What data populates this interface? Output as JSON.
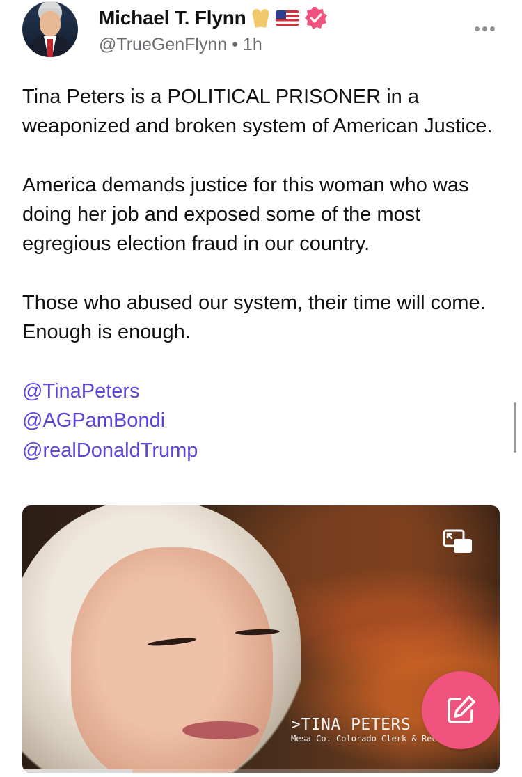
{
  "post": {
    "author": {
      "display_name": "Michael T. Flynn",
      "badges": [
        "folded-hands-emoji",
        "us-flag-emoji",
        "verified-badge-icon"
      ],
      "handle": "@TrueGenFlynn",
      "separator": "•",
      "time_ago": "1h"
    },
    "menu_icon": "more-horizontal-icon",
    "paragraphs": [
      "Tina Peters is a POLITICAL PRISONER in a weaponized and broken system of American Justice.",
      "America demands justice for this woman who was doing her job and exposed some of the most egregious election fraud in our country.",
      "Those who abused our system, their time will come. Enough is enough."
    ],
    "mentions": [
      "@TinaPeters",
      "@AGPamBondi",
      "@realDonaldTrump"
    ],
    "media": {
      "type": "video",
      "caption_main": ">TINA PETERS",
      "caption_sub": "Mesa Co. Colorado Clerk & Recorder",
      "pip_icon": "picture-in-picture-icon",
      "progress": 0.23
    }
  },
  "compose_button": {
    "icon": "compose-icon"
  },
  "colors": {
    "mention": "#5b45d8",
    "fab": "#f0537d",
    "verified": "#f0537d",
    "handle": "#6b6b70"
  }
}
